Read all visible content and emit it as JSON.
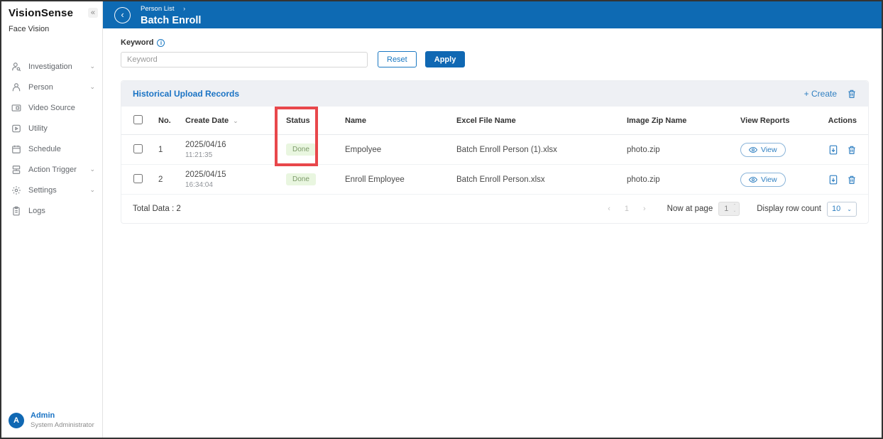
{
  "app": {
    "title": "VisionSense",
    "subtitle": "Face Vision",
    "collapse_glyph": "«"
  },
  "sidebar": {
    "items": [
      {
        "label": "Investigation",
        "icon": "investigation-icon",
        "expandable": true
      },
      {
        "label": "Person",
        "icon": "person-icon",
        "expandable": true
      },
      {
        "label": "Video Source",
        "icon": "video-source-icon",
        "expandable": false
      },
      {
        "label": "Utility",
        "icon": "utility-icon",
        "expandable": false
      },
      {
        "label": "Schedule",
        "icon": "calendar-icon",
        "expandable": false
      },
      {
        "label": "Action Trigger",
        "icon": "action-trigger-icon",
        "expandable": true
      },
      {
        "label": "Settings",
        "icon": "gear-icon",
        "expandable": true
      },
      {
        "label": "Logs",
        "icon": "logs-icon",
        "expandable": false
      }
    ],
    "chevron_glyph": "⌄",
    "user": {
      "initial": "A",
      "name": "Admin",
      "role": "System Administrator"
    }
  },
  "header": {
    "breadcrumb": "Person List",
    "separator": "›",
    "title": "Batch Enroll"
  },
  "filter": {
    "label": "Keyword",
    "info_glyph": "i",
    "placeholder": "Keyword",
    "reset_label": "Reset",
    "apply_label": "Apply"
  },
  "records": {
    "title": "Historical Upload Records",
    "create_label": "+ Create",
    "columns": {
      "no": "No.",
      "create_date": "Create Date",
      "status": "Status",
      "name": "Name",
      "excel": "Excel File Name",
      "zip": "Image Zip Name",
      "view_reports": "View Reports",
      "actions": "Actions"
    },
    "sort_glyph": "⌄",
    "rows": [
      {
        "no": "1",
        "date": "2025/04/16",
        "time": "11:21:35",
        "status": "Done",
        "name": "Empolyee",
        "excel": "Batch Enroll Person (1).xlsx",
        "zip": "photo.zip",
        "view_label": "View"
      },
      {
        "no": "2",
        "date": "2025/04/15",
        "time": "16:34:04",
        "status": "Done",
        "name": "Enroll Employee",
        "excel": "Batch Enroll Person.xlsx",
        "zip": "photo.zip",
        "view_label": "View"
      }
    ],
    "footer": {
      "total": "Total Data : 2",
      "prev_glyph": "‹",
      "page_number": "1",
      "next_glyph": "›",
      "now_at_page_label": "Now at page",
      "page_value": "1",
      "row_count_label": "Display row count",
      "row_count_value": "10",
      "select_chevron": "⌄"
    }
  },
  "colors": {
    "topbar_blue": "#0e6ab3",
    "accent_blue": "#1a78c2",
    "link_blue": "#2f7fc1",
    "done_bg": "#e9f6e0",
    "done_text": "#7d9a6a",
    "annotation_red": "#e8474b"
  }
}
